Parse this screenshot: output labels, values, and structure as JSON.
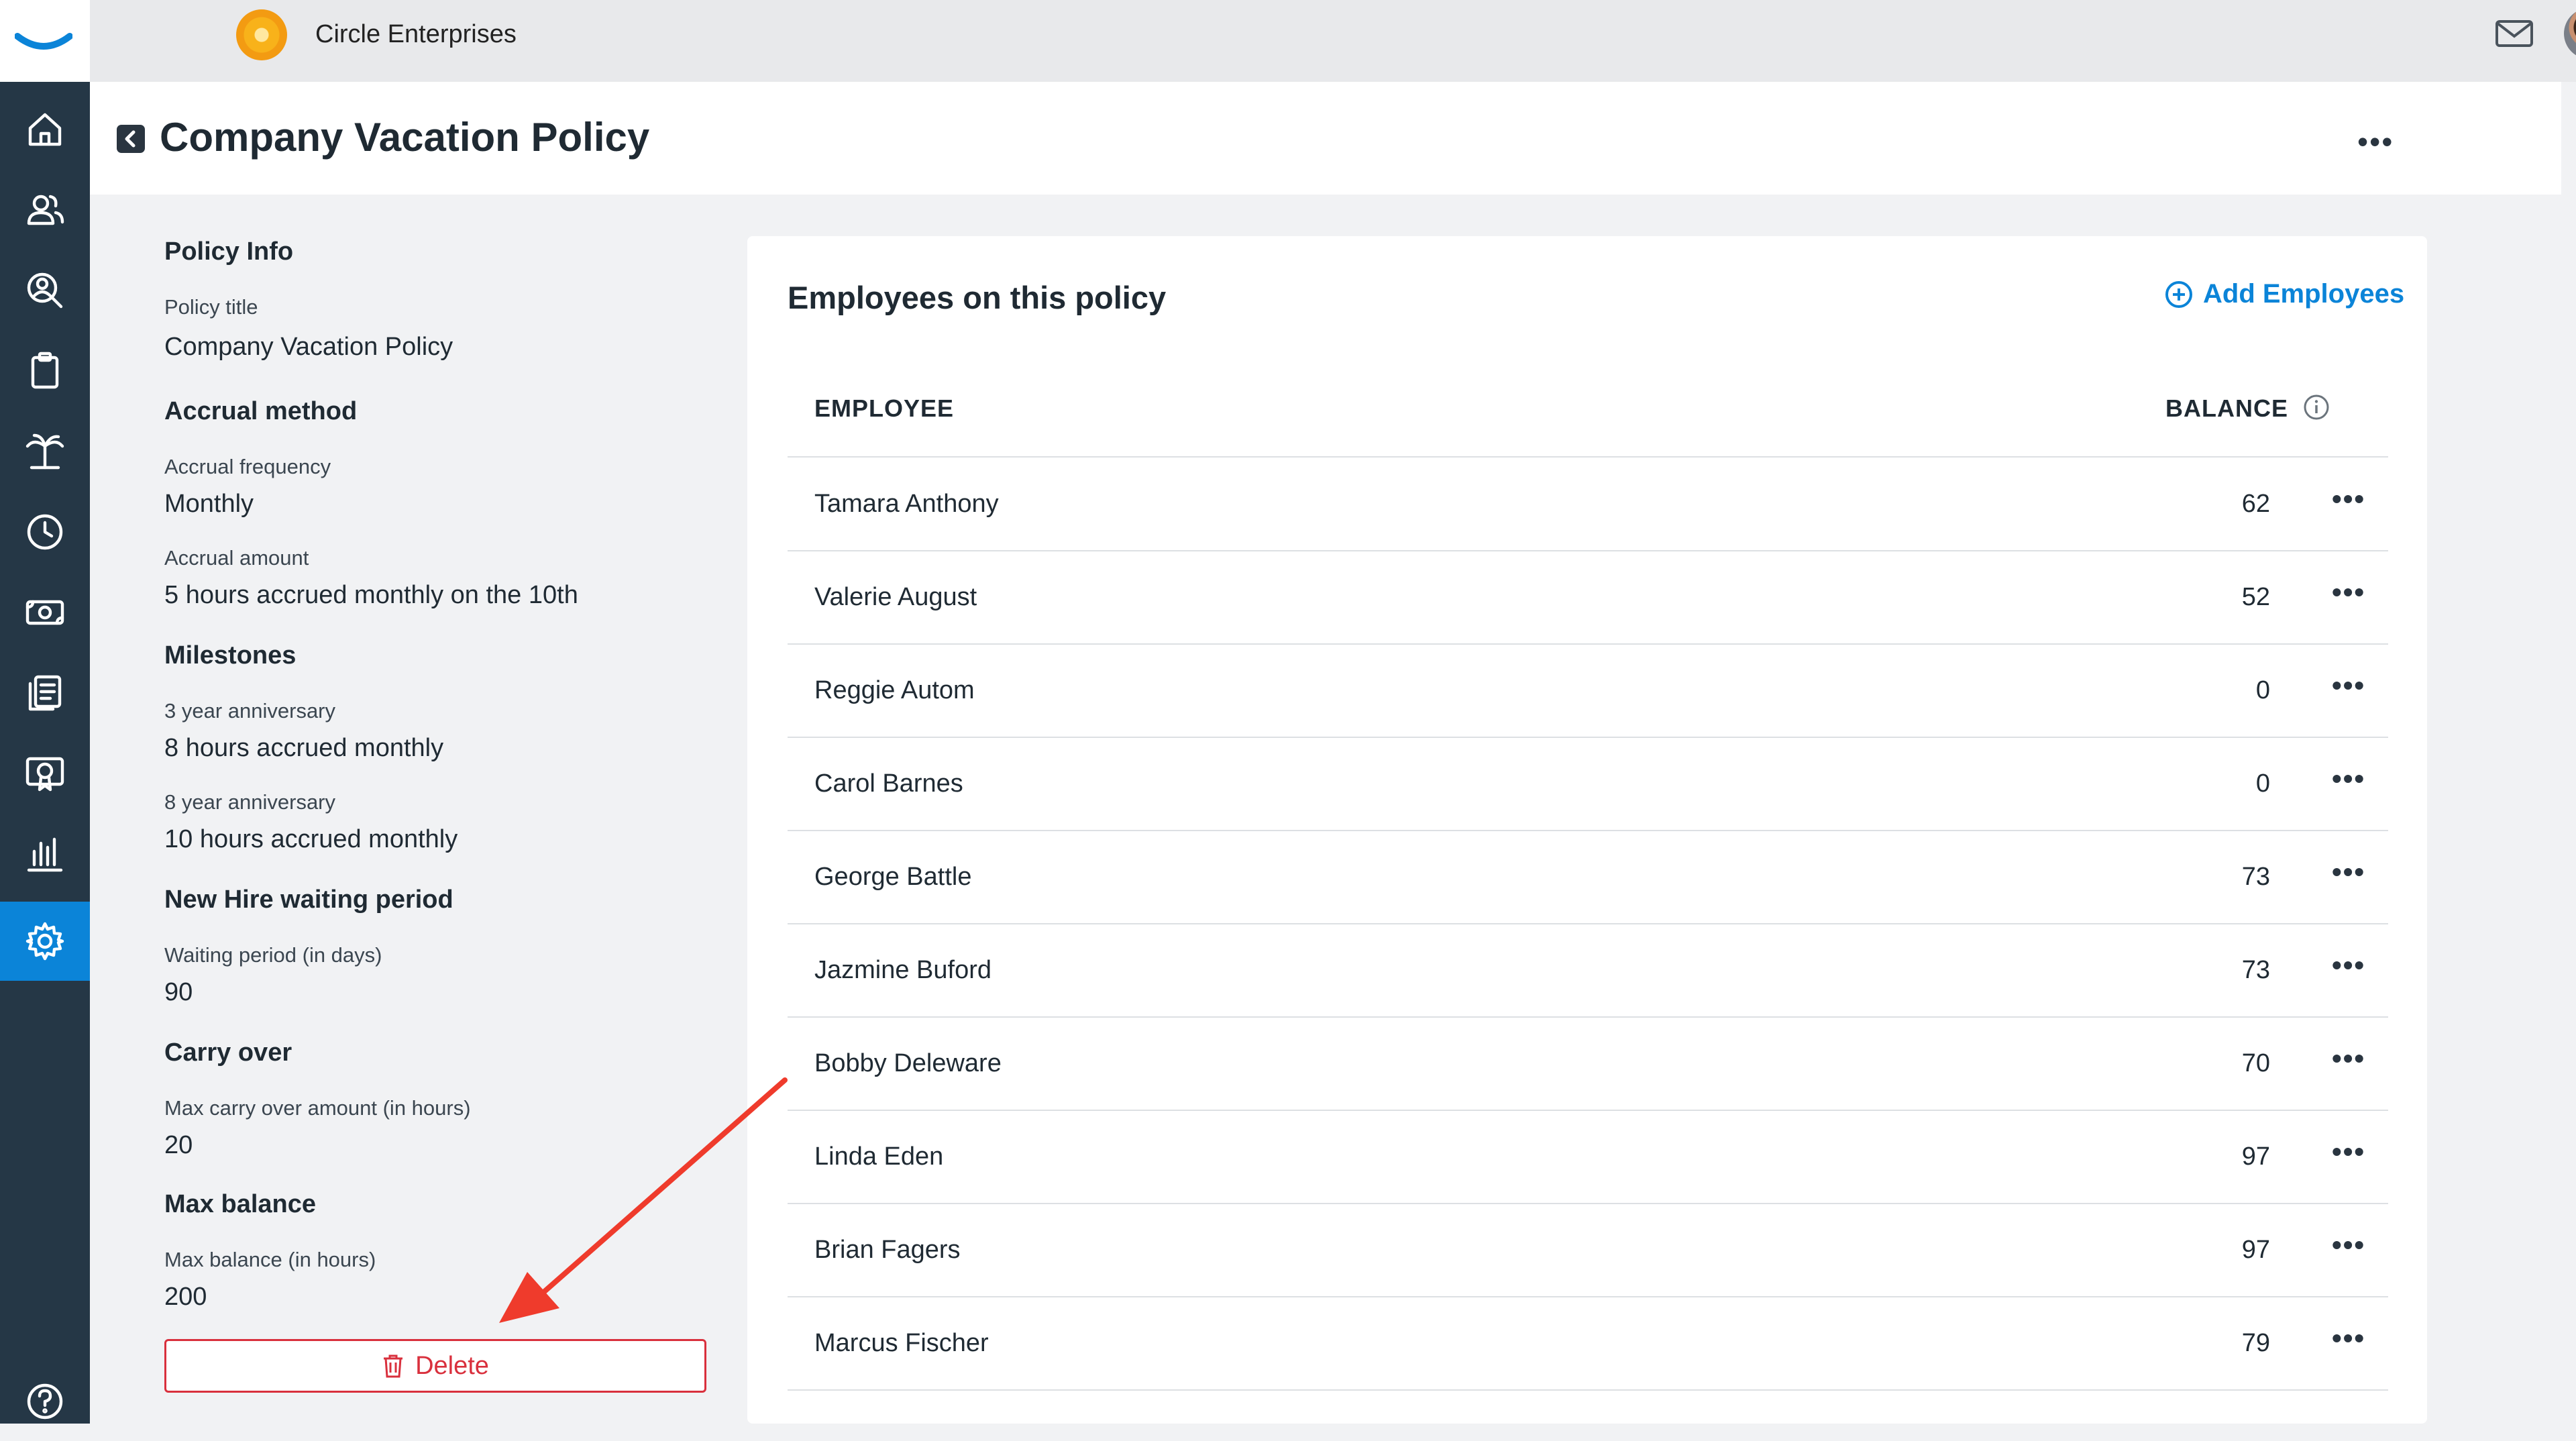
{
  "topbar": {
    "company_name": "Circle Enterprises"
  },
  "sidebar": {
    "items": [
      {
        "icon": "home-icon"
      },
      {
        "icon": "people-icon"
      },
      {
        "icon": "person-search-icon"
      },
      {
        "icon": "clipboard-icon"
      },
      {
        "icon": "palm-tree-icon"
      },
      {
        "icon": "clock-icon"
      },
      {
        "icon": "money-icon"
      },
      {
        "icon": "documents-icon"
      },
      {
        "icon": "certificate-icon"
      },
      {
        "icon": "bar-chart-icon"
      },
      {
        "icon": "gear-icon",
        "active": true
      },
      {
        "icon": "help-icon"
      }
    ],
    "active_color": "#0b84d8"
  },
  "header": {
    "title": "Company Vacation Policy"
  },
  "policy_info": {
    "heading": "Policy Info",
    "title_label": "Policy title",
    "title_value": "Company Vacation Policy",
    "accrual_heading": "Accrual method",
    "frequency_label": "Accrual frequency",
    "frequency_value": "Monthly",
    "amount_label": "Accrual amount",
    "amount_value": "5 hours accrued monthly on the 10th",
    "milestones_heading": "Milestones",
    "milestone1_label": "3 year anniversary",
    "milestone1_value": "8 hours accrued monthly",
    "milestone2_label": "8 year anniversary",
    "milestone2_value": "10 hours accrued monthly",
    "waiting_heading": "New Hire waiting period",
    "waiting_label": "Waiting period (in days)",
    "waiting_value": "90",
    "carry_heading": "Carry over",
    "carry_label": "Max carry over amount (in hours)",
    "carry_value": "20",
    "maxbal_heading": "Max balance",
    "maxbal_label": "Max balance (in hours)",
    "maxbal_value": "200",
    "delete_label": "Delete"
  },
  "employees": {
    "title": "Employees on this policy",
    "add_label": "Add Employees",
    "col_employee": "EMPLOYEE",
    "col_balance": "BALANCE",
    "rows": [
      {
        "name": "Tamara Anthony",
        "balance": "62"
      },
      {
        "name": "Valerie August",
        "balance": "52"
      },
      {
        "name": "Reggie Autom",
        "balance": "0"
      },
      {
        "name": "Carol Barnes",
        "balance": "0"
      },
      {
        "name": "George Battle",
        "balance": "73"
      },
      {
        "name": "Jazmine Buford",
        "balance": "73"
      },
      {
        "name": "Bobby Deleware",
        "balance": "70"
      },
      {
        "name": "Linda Eden",
        "balance": "97"
      },
      {
        "name": "Brian Fagers",
        "balance": "97"
      },
      {
        "name": "Marcus Fischer",
        "balance": "79"
      }
    ]
  },
  "colors": {
    "accent": "#0b84d8",
    "danger": "#d9303d",
    "sidebar": "#253746",
    "annotation": "#ef3b2c"
  }
}
